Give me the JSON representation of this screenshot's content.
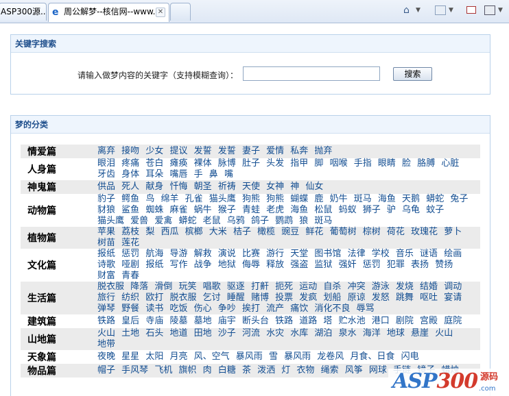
{
  "browser": {
    "tabs": [
      {
        "label": "ASP300源..."
      },
      {
        "label": "周公解梦--核信网--www..."
      }
    ]
  },
  "search_panel": {
    "title": "关键字搜索",
    "label": "请输入做梦内容的关键字（支持模糊查询）：",
    "input_value": "",
    "button_label": "搜索"
  },
  "category_panel": {
    "title": "梦的分类",
    "categories": [
      {
        "name": "情爱篇",
        "words": [
          "离弃",
          "接吻",
          "少女",
          "提议",
          "发誓",
          "发誓",
          "妻子",
          "爱情",
          "私奔",
          "抛弃"
        ]
      },
      {
        "name": "人身篇",
        "words": [
          "眼泪",
          "疼痛",
          "苍白",
          "瘫痪",
          "裸体",
          "脉博",
          "肚子",
          "头发",
          "指甲",
          "脚",
          "咽喉",
          "手指",
          "眼睛",
          "脸",
          "胳膊",
          "心脏",
          "牙齿",
          "身体",
          "耳朵",
          "嘴唇",
          "手",
          "鼻",
          "嘴"
        ]
      },
      {
        "name": "神鬼篇",
        "words": [
          "供品",
          "死人",
          "献身",
          "忏悔",
          "朝圣",
          "祈祷",
          "天使",
          "女神",
          "神",
          "仙女"
        ]
      },
      {
        "name": "动物篇",
        "words": [
          "豹子",
          "鳄鱼",
          "鸟",
          "绵羊",
          "孔雀",
          "猫头鹰",
          "狗熊",
          "狗熊",
          "蝴蝶",
          "鹿",
          "奶牛",
          "斑马",
          "海鱼",
          "天鹅",
          "蟒蛇",
          "兔子",
          "豺狼",
          "鲨鱼",
          "蜘蛛",
          "麻雀",
          "蜗牛",
          "猴子",
          "青蛙",
          "老虎",
          "海鱼",
          "松鼠",
          "蚂蚁",
          "狮子",
          "驴",
          "乌龟",
          "蚊子",
          "猫头鹰",
          "爱兽",
          "爱禽",
          "蟒蛇",
          "老鼠",
          "乌鸦",
          "鸽子",
          "鹦鹉",
          "狼",
          "斑马"
        ]
      },
      {
        "name": "植物篇",
        "words": [
          "苹果",
          "荔枝",
          "梨",
          "西瓜",
          "槟榔",
          "大米",
          "桔子",
          "橄榄",
          "豌豆",
          "鲜花",
          "葡萄树",
          "棕树",
          "荷花",
          "玫瑰花",
          "萝卜",
          "树苗",
          "莲花"
        ]
      },
      {
        "name": "文化篇",
        "words": [
          "报纸",
          "惩罚",
          "航海",
          "导游",
          "解救",
          "演说",
          "比赛",
          "游行",
          "天堂",
          "图书馆",
          "法律",
          "学校",
          "音乐",
          "谜语",
          "绘画",
          "诗歌",
          "哑剧",
          "报纸",
          "写作",
          "战争",
          "地狱",
          "侮辱",
          "释放",
          "强盗",
          "监狱",
          "强奸",
          "惩罚",
          "犯罪",
          "表扬",
          "赞扬",
          "财富",
          "青春"
        ]
      },
      {
        "name": "生活篇",
        "words": [
          "脱衣服",
          "降落",
          "滑倒",
          "玩笑",
          "唱歌",
          "驱逐",
          "打鼾",
          "扼死",
          "运动",
          "自杀",
          "冲突",
          "游泳",
          "发烧",
          "结婚",
          "调动",
          "旅行",
          "纺织",
          "欧打",
          "脱衣服",
          "乞讨",
          "睡醒",
          "赌博",
          "投票",
          "发疯",
          "划船",
          "原谅",
          "发怒",
          "跳舞",
          "呕吐",
          "宴请",
          "弹琴",
          "野餐",
          "读书",
          "吃饭",
          "伤心",
          "争吵",
          "挨打",
          "流产",
          "痛饮",
          "消化不良",
          "辱骂"
        ]
      },
      {
        "name": "建筑篇",
        "words": [
          "铁路",
          "皇后",
          "寺庙",
          "陵墓",
          "墓地",
          "庙宇",
          "断头台",
          "铁路",
          "道路",
          "塔",
          "贮水池",
          "港口",
          "剧院",
          "宫殿",
          "庭院"
        ]
      },
      {
        "name": "山地篇",
        "words": [
          "火山",
          "土地",
          "石头",
          "地道",
          "田地",
          "沙子",
          "河流",
          "水灾",
          "水库",
          "湖泊",
          "泉水",
          "海洋",
          "地球",
          "悬崖",
          "火山",
          "地带"
        ]
      },
      {
        "name": "天象篇",
        "words": [
          "夜晚",
          "星星",
          "太阳",
          "月亮",
          "风、空气",
          "暴风雨",
          "雪",
          "暴风雨",
          "龙卷风",
          "月食、日食",
          "闪电"
        ]
      },
      {
        "name": "物品篇",
        "words": [
          "帽子",
          "手风琴",
          "飞机",
          "旗帜",
          "肉",
          "白糖",
          "茶",
          "泼洒",
          "灯",
          "衣物",
          "绳索",
          "风筝",
          "网球",
          "手链",
          "镜子",
          "蜡烛"
        ]
      }
    ]
  },
  "watermark": {
    "brand_a": "ASP",
    "brand_b": "300",
    "suffix": "源码",
    "dot": ".com"
  }
}
